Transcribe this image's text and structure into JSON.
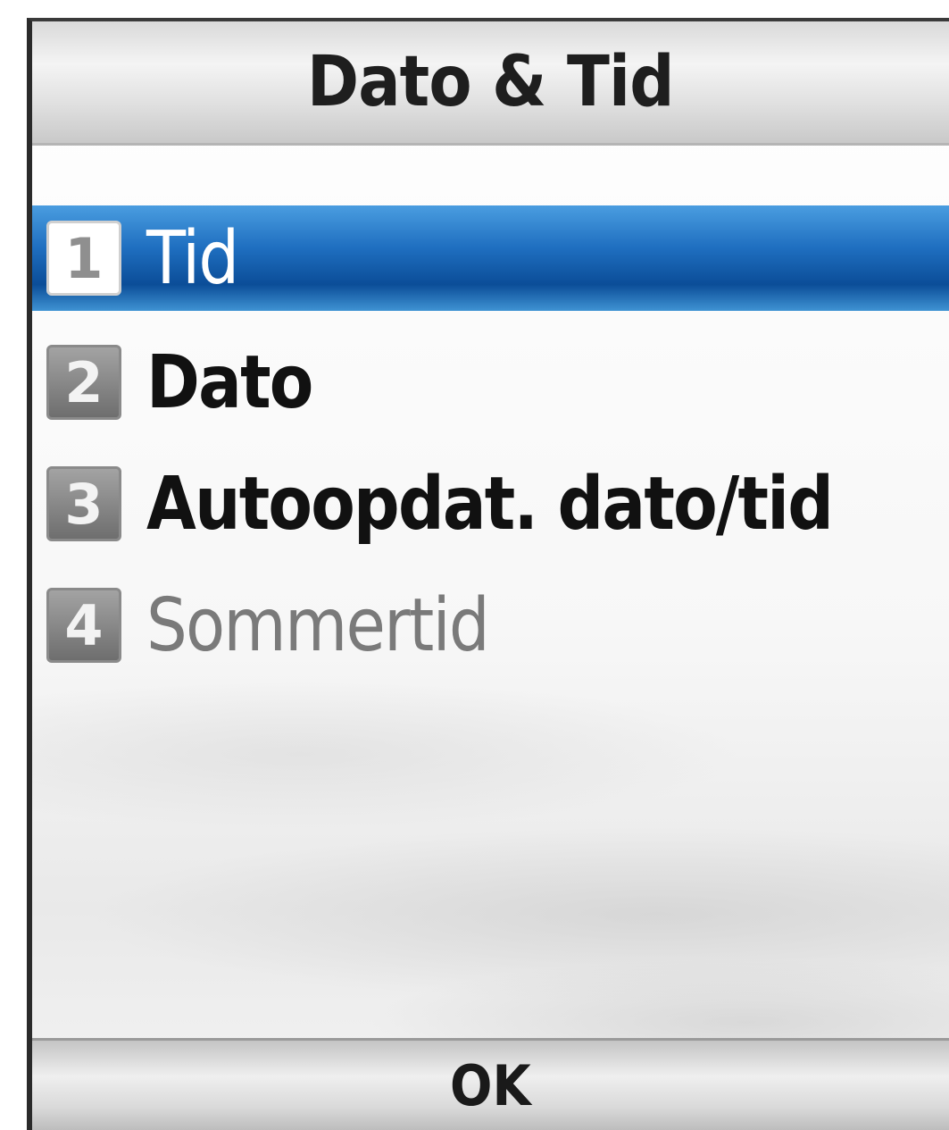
{
  "header": {
    "title": "Dato & Tid"
  },
  "menu": {
    "items": [
      {
        "number": "1",
        "label": "Tid",
        "state": "selected"
      },
      {
        "number": "2",
        "label": "Dato",
        "state": "normal"
      },
      {
        "number": "3",
        "label": "Autoopdat. dato/tid",
        "state": "normal"
      },
      {
        "number": "4",
        "label": "Sommertid",
        "state": "disabled"
      }
    ]
  },
  "softkeys": {
    "center_label": "OK"
  },
  "colors": {
    "selection": "#1f6fc0",
    "disabled_text": "#7a7a7a"
  }
}
